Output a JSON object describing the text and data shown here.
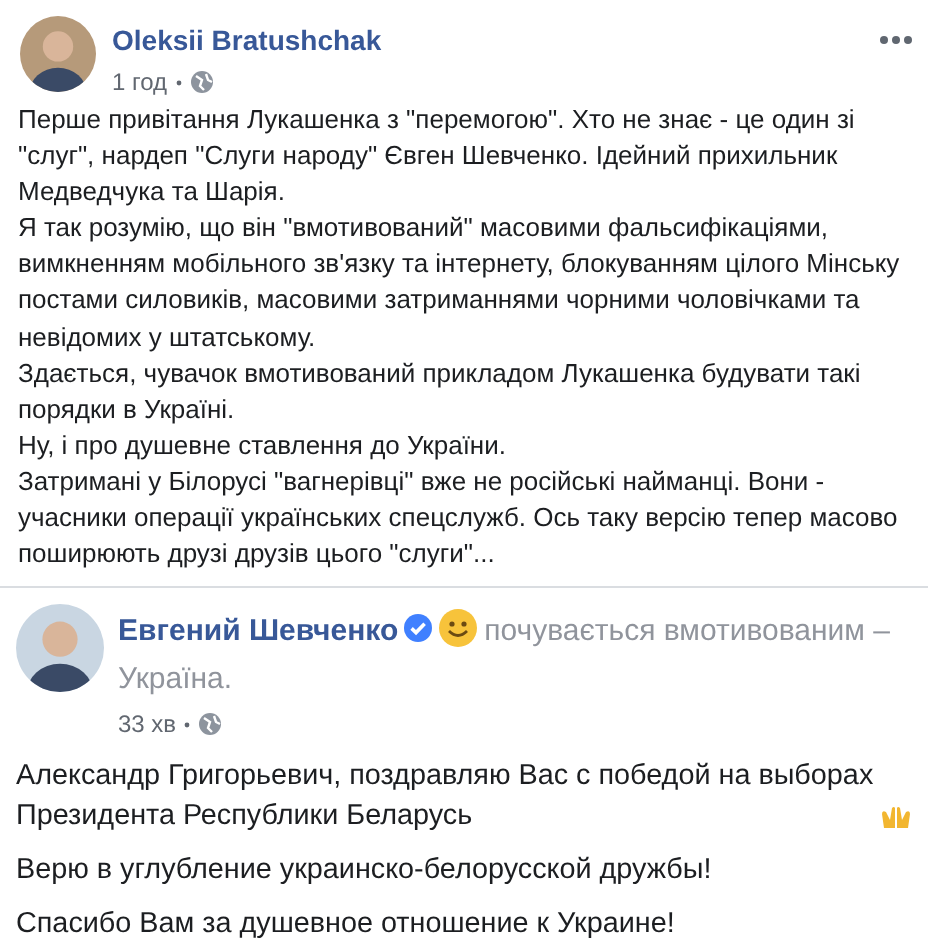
{
  "post": {
    "author": "Oleksii Bratushchak",
    "time": "1 год",
    "paragraphs": [
      "Перше привітання Лукашенка з \"перемогою\". Хто не знає - це один зі \"слуг\", нардеп \"Слуги народу\" Євген Шевченко. Ідейний прихильник Медведчука та Шарія.",
      "Я так розумію, що він \"вмотивований\" масовими фальсифікаціями, вимкненням мобільного зв'язку та інтернету, блокуванням цілого Мінську постами силовиків, масовими затриманнями чорними чоловічками та невідомих у штатському.",
      "Здається, чувачок вмотивований прикладом Лукашенка будувати такі порядки в Україні.",
      "Ну, і про душевне ставлення до України.",
      "Затримані у Білорусі \"вагнерівці\" вже не російські найманці. Вони - учасники операції українських спецслужб. Ось таку версію тепер масово поширюють друзі друзів цього \"слуги\"..."
    ]
  },
  "shared_post": {
    "author": "Евгений Шевченко",
    "verified": true,
    "feeling": "почувається вмотивованим –",
    "location": "Україна.",
    "time": "33 хв",
    "paragraphs": [
      {
        "text": "Александр Григорьевич, поздравляю Вас с победой на выборах Президента Республики Беларусь",
        "kind": "with-hands"
      },
      {
        "text": "Верю в углубление украинско-белорусской дружбы!",
        "kind": "plain"
      },
      {
        "text": "Спасибо Вам за душевное отношение к Украине!",
        "kind": "plain"
      }
    ]
  }
}
